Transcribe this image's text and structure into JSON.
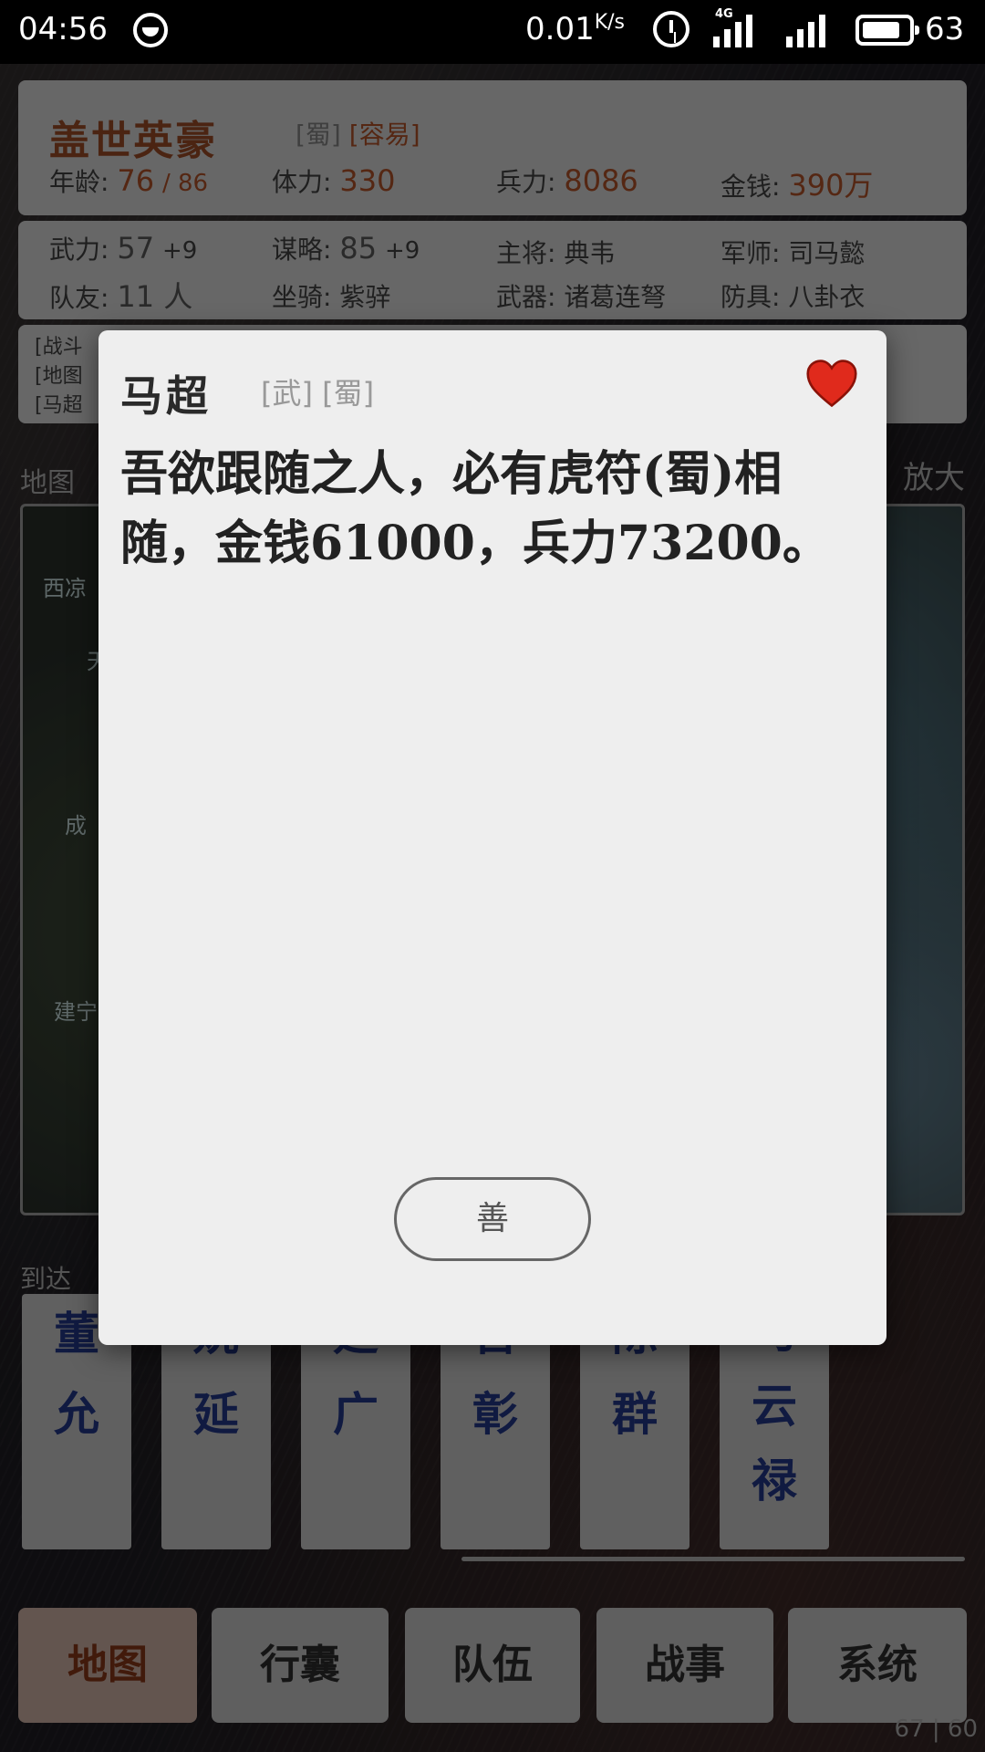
{
  "status_bar": {
    "time": "04:56",
    "speed": "0.01",
    "speed_unit": "K/s",
    "network": "4G",
    "battery": "63"
  },
  "character": {
    "title": "盖世英豪",
    "tags": [
      "[蜀]",
      "[容易]"
    ],
    "age_label": "年龄:",
    "age_value": "76",
    "age_max": "/ 86",
    "stamina_label": "体力:",
    "stamina_value": "330",
    "troops_label": "兵力:",
    "troops_value": "8086",
    "money_label": "金钱:",
    "money_value": "390万"
  },
  "stats": {
    "force_label": "武力:",
    "force_value": "57",
    "force_bonus": "+9",
    "strategy_label": "谋略:",
    "strategy_value": "85",
    "strategy_bonus": "+9",
    "general_label": "主将:",
    "general_value": "典韦",
    "advisor_label": "军师:",
    "advisor_value": "司马懿",
    "team_label": "队友:",
    "team_value": "11 人",
    "mount_label": "坐骑:",
    "mount_value": "紫骍",
    "weapon_label": "武器:",
    "weapon_value": "诸葛连弩",
    "armor_label": "防具:",
    "armor_value": "八卦衣"
  },
  "log": [
    "[战斗",
    "[地图",
    "[马超"
  ],
  "map": {
    "label": "地图",
    "zoom_label": "放大",
    "cities": [
      "西凉",
      "天",
      "成",
      "建宁"
    ]
  },
  "arrive_label": "到达",
  "cards": [
    "董\n允",
    "姚\n延",
    "廷\n广",
    "晋\n彰",
    "陈\n群",
    "马\n云\n禄"
  ],
  "tabs": [
    "地图",
    "行囊",
    "队伍",
    "战事",
    "系统"
  ],
  "fps": "67 | 60",
  "dialog": {
    "name": "马超",
    "tags": "[武] [蜀]",
    "message": "吾欲跟随之人，必有虎符(蜀)相随，金钱61000，兵力73200。",
    "button": "善",
    "heart_color": "#e02a1c"
  }
}
